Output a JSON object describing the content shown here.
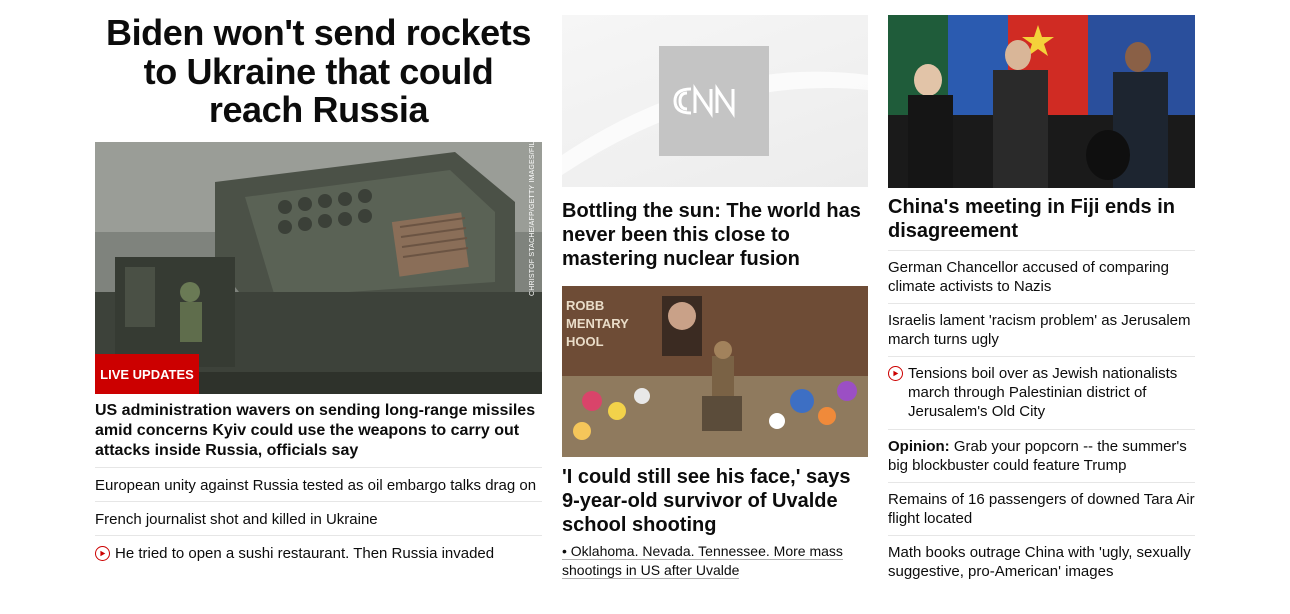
{
  "left": {
    "headline": "Biden won't send rockets to Ukraine that could reach Russia",
    "image_credit": "CHRISTOF STACHE/AFP/GETTY IMAGES/FILE",
    "badge": "LIVE UPDATES",
    "summary": "US administration wavers on sending long-range missiles amid concerns Kyiv could use the weapons to carry out attacks inside Russia, officials say",
    "links": [
      {
        "text": "European unity against Russia tested as oil embargo talks drag on",
        "video": false
      },
      {
        "text": "French journalist shot and killed in Ukraine",
        "video": false
      },
      {
        "text": "He tried to open a sushi restaurant. Then Russia invaded",
        "video": true,
        "icon": "play-icon"
      }
    ]
  },
  "middle": {
    "logo_text": "CNN",
    "headline": "Bottling the sun: The world has never been this close to mastering nuclear fusion",
    "image_sign_text": "ROBB ELEMENTARY SCHOOL",
    "headline2": "'I could still see his face,' says 9-year-old survivor of Uvalde school shooting",
    "related": "• Oklahoma. Nevada. Tennessee. More mass shootings in US after Uvalde"
  },
  "right": {
    "headline": "China's meeting in Fiji ends in disagreement",
    "links": [
      {
        "text": "German Chancellor accused of comparing climate activists to Nazis",
        "video": false,
        "prefix": ""
      },
      {
        "text": "Israelis lament 'racism problem' as Jerusalem march turns ugly",
        "video": false,
        "prefix": ""
      },
      {
        "text": "Tensions boil over as Jewish nationalists march through Palestinian district of Jerusalem's Old City",
        "video": true,
        "icon": "play-icon",
        "prefix": ""
      },
      {
        "text": "Grab your popcorn -- the summer's big blockbuster could feature Trump",
        "video": false,
        "prefix": "Opinion:"
      },
      {
        "text": "Remains of 16 passengers of downed Tara Air flight located",
        "video": false,
        "prefix": ""
      },
      {
        "text": "Math books outrage China with 'ugly, sexually suggestive, pro-American' images",
        "video": false,
        "prefix": ""
      }
    ]
  },
  "colors": {
    "accent_red": "#cc0000",
    "text": "#0c0c0c",
    "divider": "#e6e6e6"
  }
}
